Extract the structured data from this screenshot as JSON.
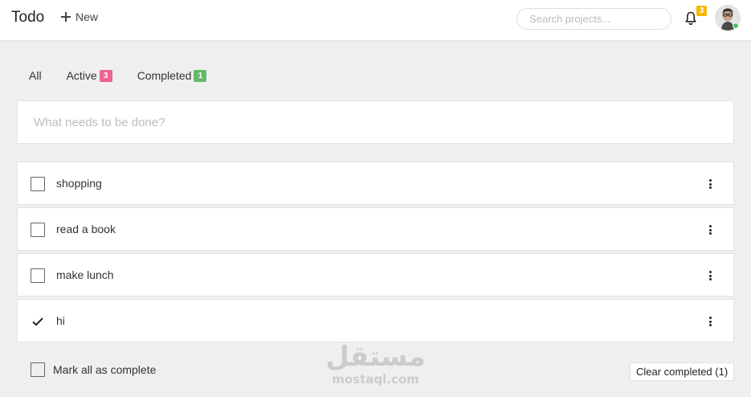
{
  "header": {
    "title": "Todo",
    "new_label": "New",
    "search_placeholder": "Search projects...",
    "notifications_count": "3"
  },
  "tabs": [
    {
      "label": "All"
    },
    {
      "label": "Active",
      "count": "3"
    },
    {
      "label": "Completed",
      "count": "1"
    }
  ],
  "new_todo": {
    "placeholder": "What needs to be done?",
    "value": ""
  },
  "todos": [
    {
      "text": "shopping",
      "completed": false
    },
    {
      "text": "read a book",
      "completed": false
    },
    {
      "text": "make lunch",
      "completed": false
    },
    {
      "text": "hi",
      "completed": true
    }
  ],
  "footer": {
    "mark_all_label": "Mark all as complete",
    "clear_completed_label": "Clear completed (1)"
  },
  "watermark": {
    "arabic": "مستقل",
    "latin": "mostaql.com"
  },
  "colors": {
    "active_badge": "#f06292",
    "completed_badge": "#66bb6a",
    "notification_badge": "#f5b800",
    "presence": "#45c26a"
  },
  "icons": {
    "new": "plus-icon",
    "notifications": "bell-icon",
    "item_menu": "more-vertical-icon",
    "done": "check-icon"
  }
}
